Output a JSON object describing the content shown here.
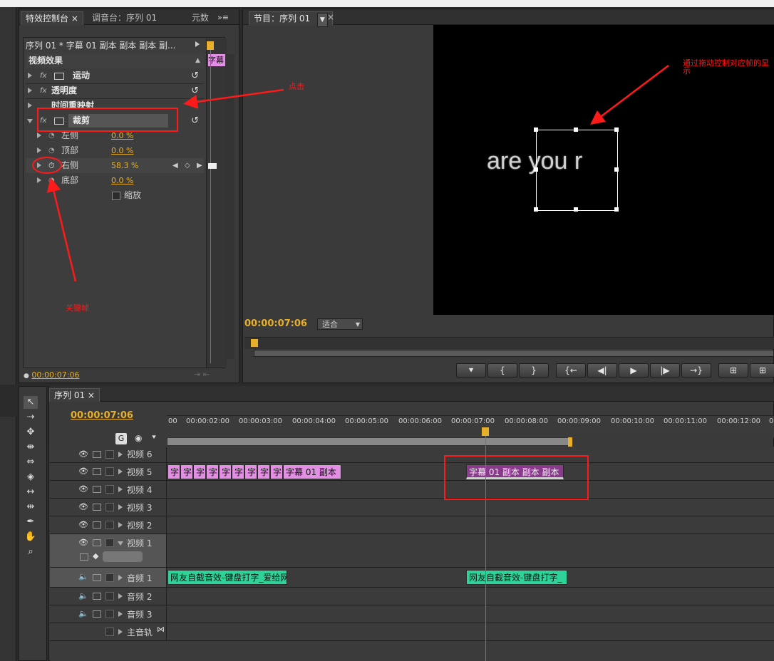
{
  "effect_controls": {
    "tabs": [
      "特效控制台",
      "调音台：序列 01",
      "元数"
    ],
    "clip_path": "序列 01 * 字幕 01 副本 副本 副本 副...",
    "mini_clip": "字幕",
    "section_title": "视频效果",
    "effects": [
      {
        "name": "运动"
      },
      {
        "name": "透明度"
      },
      {
        "name": "时间重映射"
      },
      {
        "name": "裁剪"
      }
    ],
    "params": [
      {
        "name": "左侧",
        "value": "0.0 %"
      },
      {
        "name": "顶部",
        "value": "0.0 %"
      },
      {
        "name": "右侧",
        "value": "58.3 %"
      },
      {
        "name": "底部",
        "value": "0.0 %"
      }
    ],
    "zoom_label": "缩放",
    "timecode": "00:00:07:06"
  },
  "program": {
    "tab": "节目：序列 01",
    "video_text": "are you r",
    "timecode": "00:00:07:06",
    "fit": "适合"
  },
  "timeline": {
    "tab": "序列 01",
    "timecode": "00:00:07:06",
    "ruler": [
      "00",
      "00:00:02:00",
      "00:00:03:00",
      "00:00:04:00",
      "00:00:05:00",
      "00:00:06:00",
      "00:00:07:00",
      "00:00:08:00",
      "00:00:09:00",
      "00:00:10:00",
      "00:00:11:00",
      "00:00:12:00",
      "0"
    ],
    "tracks": [
      "视频 6",
      "视频 5",
      "视频 4",
      "视频 3",
      "视频 2",
      "视频 1",
      "音频 1",
      "音频 2",
      "音频 3",
      "主音轨"
    ],
    "clip_v5a_chars": [
      "字",
      "字",
      "字",
      "字",
      "字",
      "字",
      "字",
      "字",
      "字"
    ],
    "clip_v5a_last": "字幕 01 副本",
    "clip_v5b": "字幕 01 副本 副本 副本",
    "clip_a1a": "网友自截音效-键盘打字_爱给网",
    "clip_a1b": "网友自截音效-键盘打字_"
  },
  "annotations": {
    "click": "点击",
    "keyframe": "关键帧",
    "drag": "通过拖动控制对应帧的显示"
  },
  "colors": {
    "accent": "#e8b02a",
    "title_clip": "#e38fe3",
    "title_clip_dark": "#8a3a8a",
    "audio_clip": "#2fd39a",
    "annotation": "#ff1a1a"
  }
}
